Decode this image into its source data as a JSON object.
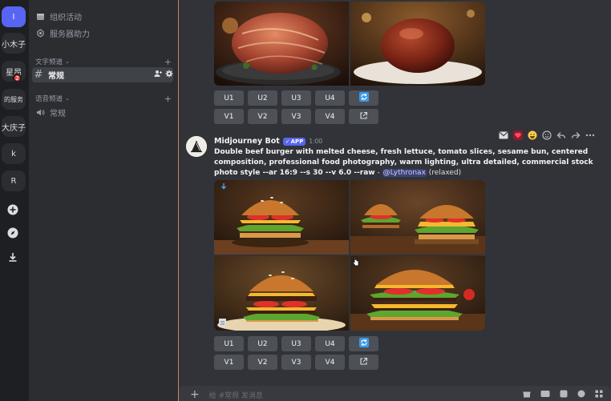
{
  "rail": {
    "active": "I",
    "servers": [
      "小木子",
      "星昂",
      "的服务",
      "大庆子",
      "k",
      "R"
    ],
    "badge": "2"
  },
  "sidebar": {
    "items": [
      {
        "label": "组织活动",
        "icon": "calendar-icon"
      },
      {
        "label": "服务器助力",
        "icon": "boost-icon"
      }
    ],
    "text_category": "文字频道",
    "text_channel": "常规",
    "voice_category": "语音频道",
    "voice_channel": "常规"
  },
  "buttons": {
    "upscale": [
      "U1",
      "U2",
      "U3",
      "U4"
    ],
    "variation": [
      "V1",
      "V2",
      "V3",
      "V4"
    ]
  },
  "message": {
    "author": "Midjourney Bot",
    "app_badge": "APP",
    "time": "1:00",
    "prompt": "Double beef burger with melted cheese, fresh lettuce, tomato slices, sesame bun, centered composition, professional food photography, warm lighting, ultra detailed, commercial stock photo style --ar 16:9 --s 30 --v 6.0 --raw",
    "dash": " - ",
    "mention": "@Lythronax",
    "status": " (relaxed)"
  },
  "composer": {
    "placeholder": "给 #常规 发消息"
  },
  "colors": {
    "accent": "#5865f2",
    "button": "#4e5058",
    "bg_main": "#313338",
    "bg_sidebar": "#2b2d31",
    "bg_rail": "#1e1f22"
  }
}
